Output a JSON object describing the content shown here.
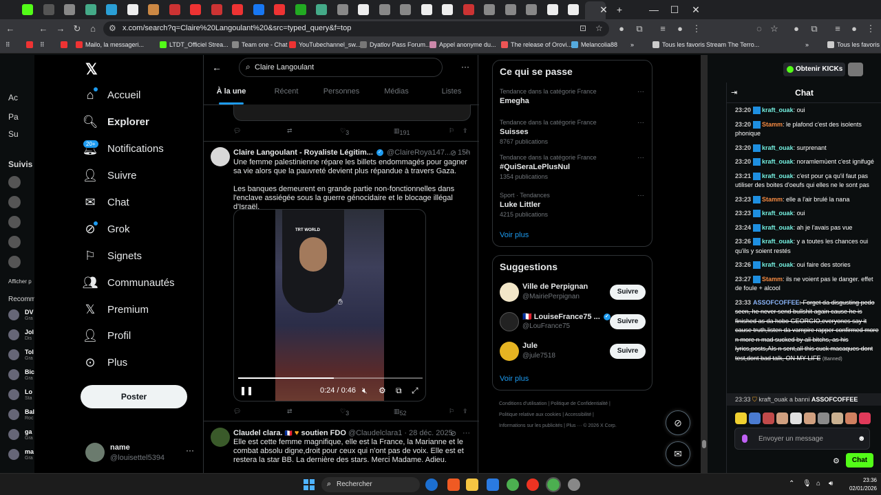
{
  "browser": {
    "url": "x.com/search?q=Claire%20Langoulant%20&src=typed_query&f=top",
    "bookmarks": [
      "Mailo, la messageri...",
      "LTDT_Officiel Strea...",
      "Team one - Chat",
      "YouTubechannel_sw...",
      "Dyatlov Pass Forum...",
      "Appel anonyme du...",
      "The release of Orovi...",
      "Melancolia88",
      "Tous les favoris"
    ],
    "bookmark_right_1": "Stream The Terro...",
    "bookmark_right_2": "Tous les favoris"
  },
  "kick_left": {
    "items": [
      "Ac",
      "Pa",
      "Su"
    ],
    "follow_header": "Suivis",
    "show_more": "Afficher p",
    "recommended": "Recomm",
    "rec_items": [
      "DV",
      "Jol",
      "Tol",
      "Bic",
      "Lo",
      "Bal",
      "ga",
      "ma"
    ],
    "rec_sub": [
      "Gra",
      "Dis",
      "Gra",
      "Gra",
      "Sta",
      "Roc",
      "Gra",
      "Gra"
    ]
  },
  "nav": {
    "home": "Accueil",
    "explore": "Explorer",
    "notifications": "Notifications",
    "notif_badge": "20+",
    "follow": "Suivre",
    "chat": "Chat",
    "grok": "Grok",
    "bookmarks": "Signets",
    "communities": "Communautés",
    "premium": "Premium",
    "profile": "Profil",
    "more": "Plus",
    "post_button": "Poster",
    "account_name": "name",
    "account_handle": "@louisettel5394",
    "account_more": "···"
  },
  "search": {
    "query": "Claire Langoulant",
    "tabs": [
      "À la une",
      "Récent",
      "Personnes",
      "Médias",
      "Listes"
    ]
  },
  "prev_actions": {
    "likes": "3",
    "views": "191"
  },
  "tweet1": {
    "name": "Claire Langoulant - Royaliste Légitim...",
    "handle": "@ClaireRoya147...",
    "time": "· 15h",
    "text1": "Une femme palestinienne répare les billets endommagés pour gagner sa vie alors que la pauvreté devient plus répandue à travers Gaza.",
    "text2": "Les banques demeurent en grande partie non-fonctionnelles dans l'enclave assiégée sous la guerre génocidaire et le blocage illégal d'Israël.",
    "video_watermark": "TRT WORLD",
    "video_time": "0:24 / 0:46",
    "video_progress": 0.52,
    "likes": "3",
    "views": "52"
  },
  "tweet2": {
    "name": "Claudel clara.",
    "name_suffix": "soutien FDO",
    "handle": "@Claudelclara1 · 28 déc. 2025",
    "text": "Elle est cette femme magnifique, elle est la France, la Marianne et le combat absolu digne,droit pour ceux qui n'ont pas de voix. Elle est et restera la star BB. La dernière des stars. Merci Madame.  Adieu."
  },
  "trends": {
    "title": "Ce qui se passe",
    "items": [
      {
        "category": "Tendance dans la catégorie France",
        "name": "Emegha",
        "posts": ""
      },
      {
        "category": "Tendance dans la catégorie France",
        "name": "Suisses",
        "posts": "8767 publications"
      },
      {
        "category": "Tendance dans la catégorie France",
        "name": "#QuiSeraLePlusNul",
        "posts": "1354 publications"
      },
      {
        "category": "Sport · Tendances",
        "name": "Luke Littler",
        "posts": "4215 publications"
      }
    ],
    "see_more": "Voir plus"
  },
  "suggestions": {
    "title": "Suggestions",
    "items": [
      {
        "name": "Ville de Perpignan",
        "handle": "@MairiePerpignan",
        "button": "Suivre"
      },
      {
        "name": "LouiseFrance75 ...",
        "handle": "@LouFrance75",
        "button": "Suivre"
      },
      {
        "name": "Jule",
        "handle": "@jule7518",
        "button": "Suivre"
      }
    ],
    "see_more": "Voir plus"
  },
  "footer": {
    "line1": "Conditions d'utilisation  |  Politique de Confidentialité  |",
    "line2": "Politique relative aux cookies  |  Accessibilité  |",
    "line3": "Informations sur les publicités  |  Plus ···  © 2026 X Corp."
  },
  "kick": {
    "kicks_button": "Obtenir KICKs",
    "chat_title": "Chat",
    "messages": [
      {
        "time": "23:20",
        "user": "kraft_ouak",
        "cls": "u1",
        "text": ": oui"
      },
      {
        "time": "23:20",
        "user": "Stamm",
        "cls": "u2",
        "text": ": le plafond c'est des isolents phonique"
      },
      {
        "time": "23:20",
        "user": "kraft_ouak",
        "cls": "u1",
        "text": ": surprenant"
      },
      {
        "time": "23:20",
        "user": "kraft_ouak",
        "cls": "u1",
        "text": ": noramlemùent c'est ignifugé"
      },
      {
        "time": "23:21",
        "user": "kraft_ouak",
        "cls": "u1",
        "text": ": c'est pour ça qu'il faut pas utiliser des boites d'oeufs qui elles ne le sont pas"
      },
      {
        "time": "23:23",
        "user": "Stamm",
        "cls": "u2",
        "text": ": elle a l'air brulé la nana"
      },
      {
        "time": "23:23",
        "user": "kraft_ouak",
        "cls": "u1",
        "text": ": oui"
      },
      {
        "time": "23:24",
        "user": "kraft_ouak",
        "cls": "u1",
        "text": ": ah je l'avais pas vue"
      },
      {
        "time": "23:26",
        "user": "kraft_ouak",
        "cls": "u1",
        "text": ": y a toutes les chances oui qu'ils y soient restés"
      },
      {
        "time": "23:26",
        "user": "kraft_ouak",
        "cls": "u1",
        "text": ": oui faire des stories"
      },
      {
        "time": "23:27",
        "user": "Stamm",
        "cls": "u2",
        "text": ": ils ne voient pas le danger. effet de foule + alcool"
      }
    ],
    "banned_msg": {
      "time": "23:33",
      "user": "ASSOFCOFFEE",
      "text": ": Forget da disgusting pedo seen, he never send bullshit again cause he is finished as da hobo GEORGIO,everyones say it cause truth,listen da vampire rapper confirmed more n more n mad sucked by all bitchs, as his lyrics,posts,AIs n sent,all this cuck macaques dont test,dont bad talk, ON MY LIFE",
      "tag": "(Banned)"
    },
    "ban_line": {
      "time": "23:33",
      "user": "kraft_ouak",
      "action": "a banni",
      "target": "ASSOFCOFFEE"
    },
    "input_placeholder": "Envoyer un message",
    "send_button": "Chat"
  },
  "taskbar": {
    "search": "Rechercher",
    "time": "23:36",
    "date": "02/01/2026"
  }
}
